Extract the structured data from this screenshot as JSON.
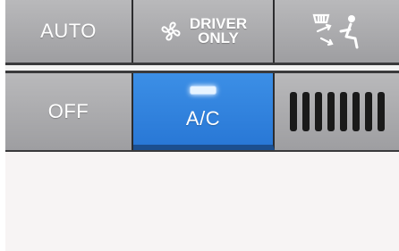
{
  "top_row": {
    "auto_label": "AUTO",
    "driver_only_line1": "DRIVER",
    "driver_only_line2": "ONLY",
    "fan_icon": "fan-icon",
    "defog_icon": "windshield-defrost-airflow-icon"
  },
  "bottom_row": {
    "off_label": "OFF",
    "ac_label": "A/C",
    "ac_indicator": "on",
    "vent_icon": "air-vent-icon"
  },
  "colors": {
    "active_blue": "#2f84df",
    "button_gray": "#a9a9ac",
    "panel_dark": "#3a3a3c"
  }
}
